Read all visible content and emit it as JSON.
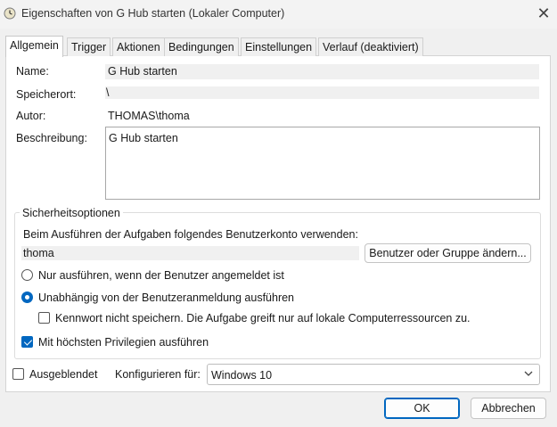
{
  "window": {
    "title": "Eigenschaften von G Hub starten (Lokaler Computer)",
    "close_glyph": "✕"
  },
  "tabs": [
    {
      "label": "Allgemein",
      "active": true
    },
    {
      "label": "Trigger",
      "active": false
    },
    {
      "label": "Aktionen",
      "active": false
    },
    {
      "label": "Bedingungen",
      "active": false
    },
    {
      "label": "Einstellungen",
      "active": false
    },
    {
      "label": "Verlauf (deaktiviert)",
      "active": false
    }
  ],
  "general": {
    "name_label": "Name:",
    "name_value": "G Hub starten",
    "location_label": "Speicherort:",
    "location_value": "\\",
    "author_label": "Autor:",
    "author_value": "THOMAS\\thoma",
    "description_label": "Beschreibung:",
    "description_value": "G Hub starten"
  },
  "security": {
    "group_title": "Sicherheitsoptionen",
    "account_prompt": "Beim Ausführen der Aufgaben folgendes Benutzerkonto verwenden:",
    "account_value": "thoma",
    "change_user_button": "Benutzer oder Gruppe ändern...",
    "radio_logged_on": {
      "label": "Nur ausführen, wenn der Benutzer angemeldet ist",
      "checked": false
    },
    "radio_independent": {
      "label": "Unabhängig von der Benutzeranmeldung ausführen",
      "checked": true
    },
    "check_no_password": {
      "label": "Kennwort nicht speichern. Die Aufgabe greift nur auf lokale Computerressourcen zu.",
      "checked": false
    },
    "check_highest": {
      "label": "Mit höchsten Privilegien ausführen",
      "checked": true
    }
  },
  "footer": {
    "hidden_label": "Ausgeblendet",
    "hidden_checked": false,
    "configure_label": "Konfigurieren für:",
    "configure_value": "Windows 10"
  },
  "buttons": {
    "ok": "OK",
    "cancel": "Abbrechen"
  },
  "colors": {
    "accent": "#0067c0",
    "panel": "#ffffff",
    "window_bg": "#f0f0f0"
  },
  "icons": {
    "app": "task-scheduler-clock-icon",
    "dropdown": "chevron-down-icon",
    "close": "close-icon"
  }
}
